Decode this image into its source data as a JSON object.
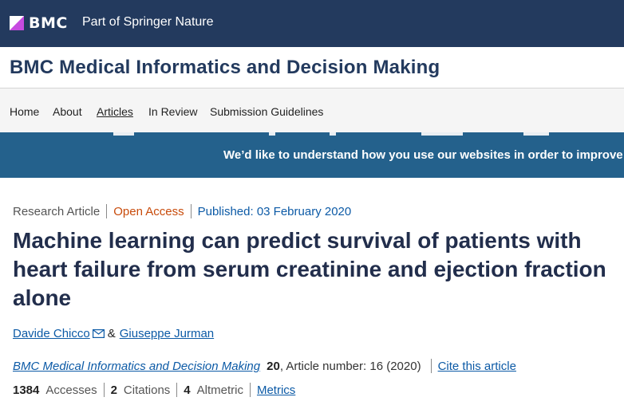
{
  "brand": {
    "logo_text": "BMC",
    "tagline": "Part of Springer Nature",
    "colors": {
      "bar": "#233a5e",
      "logo_accent": "#c74be0"
    }
  },
  "journal": {
    "title": "BMC Medical Informatics and Decision Making"
  },
  "nav": {
    "items": [
      {
        "label": "Home"
      },
      {
        "label": "About"
      },
      {
        "label": "Articles",
        "active": true
      },
      {
        "label": "In Review"
      },
      {
        "label": "Submission Guidelines"
      }
    ]
  },
  "banner": {
    "text": "We’d like to understand how you use our websites in order to improve",
    "color": "#24618c"
  },
  "article": {
    "type": "Research Article",
    "access": "Open Access",
    "published": "Published: 03 February 2020",
    "title": "Machine learning can predict survival of patients with heart failure from serum creatinine and ejection fraction alone",
    "authors": [
      {
        "name": "Davide Chicco",
        "icon": "mail-icon"
      },
      {
        "name": "Giuseppe Jurman"
      }
    ],
    "author_joiner": "&",
    "citation": {
      "journal": "BMC Medical Informatics and Decision Making",
      "volume": "20",
      "article_number": ", Article number: 16 (2020)",
      "cite_link": "Cite this article"
    },
    "metrics": {
      "accesses": {
        "value": "1384",
        "label": "Accesses"
      },
      "citations": {
        "value": "2",
        "label": "Citations"
      },
      "altmetric": {
        "value": "4",
        "label": "Altmetric"
      },
      "link": "Metrics"
    },
    "colors": {
      "link": "#0c5aa6",
      "open_access": "#c84b0b"
    }
  }
}
